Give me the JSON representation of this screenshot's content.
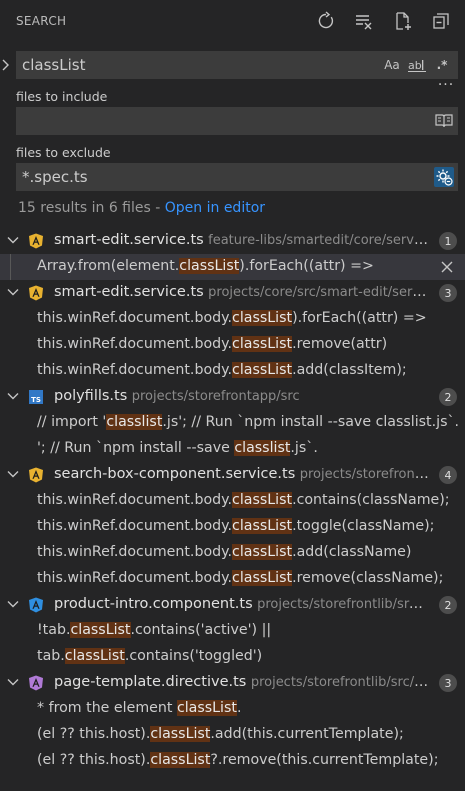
{
  "header": {
    "title": "SEARCH",
    "icons": [
      "refresh-icon",
      "clear-results-icon",
      "new-search-editor-icon",
      "collapse-all-icon"
    ]
  },
  "search": {
    "value": "classList",
    "options": {
      "match_case": "Aa",
      "whole_word": "ab",
      "regex": ".*"
    }
  },
  "include": {
    "label": "files to include",
    "value": ""
  },
  "exclude": {
    "label": "files to exclude",
    "value": "*.spec.ts"
  },
  "summary": {
    "text": "15 results in 6 files - ",
    "link": "Open in editor"
  },
  "colors": {
    "background": "#252526",
    "input_bg": "#3c3c3c",
    "match_highlight": "#613214",
    "link": "#3794ff",
    "angular_icon": "#e8b230",
    "angular_component_icon": "#2f8fe0",
    "angular_directive_icon": "#b07ad6",
    "ts_icon": "#3178c6"
  },
  "results": [
    {
      "file": "smart-edit.service.ts",
      "path": "feature-libs/smartedit/core/servi...",
      "icon": "angular-service-icon",
      "count": "1",
      "matches": [
        {
          "pre": "Array.from(element.",
          "match": "classList",
          "post": ").forEach((attr) =>",
          "selected": true
        }
      ]
    },
    {
      "file": "smart-edit.service.ts",
      "path": "projects/core/src/smart-edit/serv...",
      "icon": "angular-service-icon",
      "count": "3",
      "matches": [
        {
          "pre": "this.winRef.document.body.",
          "match": "classList",
          "post": ").forEach((attr) =>"
        },
        {
          "pre": "this.winRef.document.body.",
          "match": "classList",
          "post": ".remove(attr)"
        },
        {
          "pre": "this.winRef.document.body.",
          "match": "classList",
          "post": ".add(classItem);"
        }
      ]
    },
    {
      "file": "polyfills.ts",
      "path": "projects/storefrontapp/src",
      "icon": "typescript-icon",
      "count": "2",
      "matches": [
        {
          "pre": "// import '",
          "match": "classlist",
          "post": ".js';  // Run `npm install --save classlist.js`."
        },
        {
          "pre": "';  // Run `npm install --save ",
          "match": "classlist",
          "post": ".js`."
        }
      ]
    },
    {
      "file": "search-box-component.service.ts",
      "path": "projects/storefront...",
      "icon": "angular-service-icon",
      "count": "4",
      "matches": [
        {
          "pre": "this.winRef.document.body.",
          "match": "classList",
          "post": ".contains(className);"
        },
        {
          "pre": "this.winRef.document.body.",
          "match": "classList",
          "post": ".toggle(className);"
        },
        {
          "pre": "this.winRef.document.body.",
          "match": "classList",
          "post": ".add(className)"
        },
        {
          "pre": "this.winRef.document.body.",
          "match": "classList",
          "post": ".remove(className);"
        }
      ]
    },
    {
      "file": "product-intro.component.ts",
      "path": "projects/storefrontlib/src/...",
      "icon": "angular-component-icon",
      "count": "2",
      "matches": [
        {
          "pre": "!tab.",
          "match": "classList",
          "post": ".contains('active') ||"
        },
        {
          "pre": "tab.",
          "match": "classList",
          "post": ".contains('toggled')"
        }
      ]
    },
    {
      "file": "page-template.directive.ts",
      "path": "projects/storefrontlib/src/c...",
      "icon": "angular-directive-icon",
      "count": "3",
      "matches": [
        {
          "pre": "* from the element ",
          "match": "classList",
          "post": "."
        },
        {
          "pre": "(el ?? this.host).",
          "match": "classList",
          "post": ".add(this.currentTemplate);"
        },
        {
          "pre": "(el ?? this.host).",
          "match": "classList",
          "post": "?.remove(this.currentTemplate);"
        }
      ]
    }
  ]
}
